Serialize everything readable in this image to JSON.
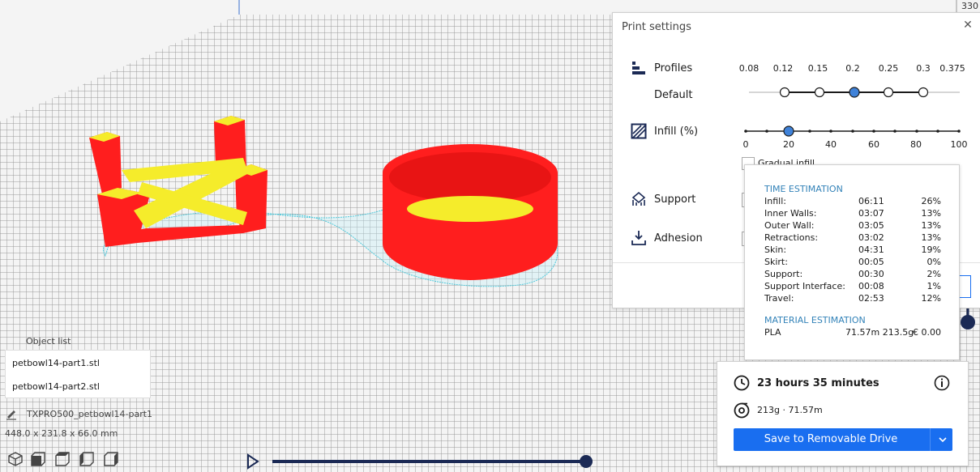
{
  "viewport": {
    "axis_label": "330"
  },
  "print_settings": {
    "title": "Print settings",
    "profiles": {
      "label": "Profiles",
      "sublabel": "Default",
      "ticks": [
        "0.08",
        "0.12",
        "0.15",
        "0.2",
        "0.25",
        "0.3",
        "0.375"
      ],
      "selected": "0.2"
    },
    "infill": {
      "label": "Infill (%)",
      "ticks": [
        "0",
        "20",
        "40",
        "60",
        "80",
        "100"
      ],
      "value": 20,
      "gradual_label": "Gradual infill"
    },
    "support": {
      "label": "Support"
    },
    "adhesion": {
      "label": "Adhesion"
    }
  },
  "time_estimation": {
    "title": "TIME ESTIMATION",
    "rows": [
      {
        "name": "Infill:",
        "time": "06:11",
        "pct": "26%"
      },
      {
        "name": "Inner Walls:",
        "time": "03:07",
        "pct": "13%"
      },
      {
        "name": "Outer Wall:",
        "time": "03:05",
        "pct": "13%"
      },
      {
        "name": "Retractions:",
        "time": "03:02",
        "pct": "13%"
      },
      {
        "name": "Skin:",
        "time": "04:31",
        "pct": "19%"
      },
      {
        "name": "Skirt:",
        "time": "00:05",
        "pct": "0%"
      },
      {
        "name": "Support:",
        "time": "00:30",
        "pct": "2%"
      },
      {
        "name": "Support Interface:",
        "time": "00:08",
        "pct": "1%"
      },
      {
        "name": "Travel:",
        "time": "02:53",
        "pct": "12%"
      }
    ]
  },
  "material_estimation": {
    "title": "MATERIAL ESTIMATION",
    "material": "PLA",
    "length_weight": "71.57m 213.5g",
    "cost": "€ 0.00"
  },
  "job": {
    "duration": "23 hours 35 minutes",
    "material_summary": "213g · 71.57m",
    "save_label": "Save to Removable Drive"
  },
  "object_list": {
    "title": "Object list",
    "items": [
      "petbowl14-part1.stl",
      "petbowl14-part2.stl"
    ],
    "job_name": "TXPRO500_petbowl14-part1",
    "dimensions": "448.0 x 231.8 x 66.0 mm"
  },
  "colors": {
    "accent": "#196ef0",
    "model_red": "#ff1e1e",
    "model_yellow": "#f5ec2b",
    "outline_cyan": "#7fe0ee",
    "grid_line": "#9a9a9a"
  }
}
